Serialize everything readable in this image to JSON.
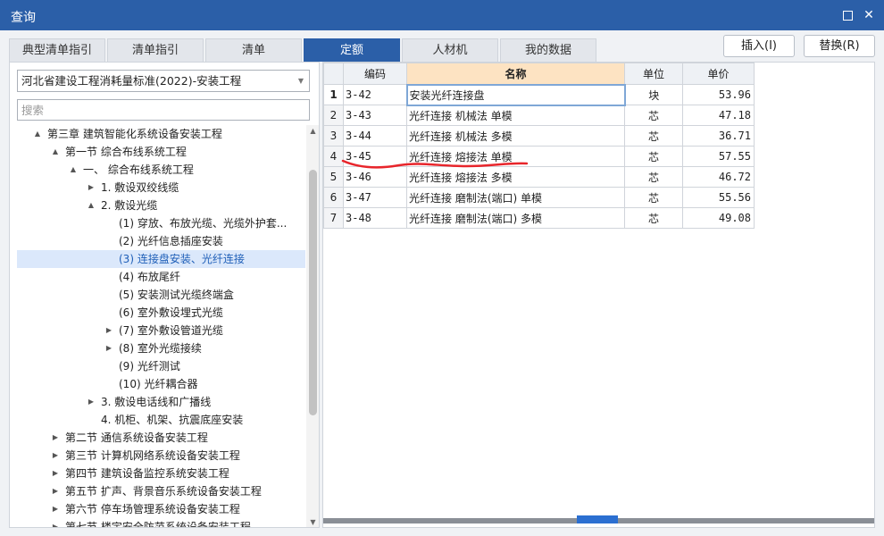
{
  "window": {
    "title": "查询",
    "max_icon": "maximize-icon",
    "close_icon": "close-icon"
  },
  "tabs": [
    {
      "label": "典型清单指引"
    },
    {
      "label": "清单指引"
    },
    {
      "label": "清单"
    },
    {
      "label": "定额",
      "active": true
    },
    {
      "label": "人材机"
    },
    {
      "label": "我的数据"
    }
  ],
  "actions": {
    "insert": "插入(I)",
    "replace": "替换(R)"
  },
  "left": {
    "standard": "河北省建设工程消耗量标准(2022)-安装工程",
    "search_placeholder": "搜索",
    "tree": [
      {
        "label": "第三章 建筑智能化系统设备安装工程",
        "toggle": "▲",
        "level": 1
      },
      {
        "label": "第一节 综合布线系统工程",
        "toggle": "▲",
        "level": 2
      },
      {
        "label": "一、 综合布线系统工程",
        "toggle": "▲",
        "level": 3
      },
      {
        "label": "1. 敷设双绞线缆",
        "toggle": "▶",
        "level": 4
      },
      {
        "label": "2. 敷设光缆",
        "toggle": "▲",
        "level": 4
      },
      {
        "label": "(1) 穿放、布放光缆、光缆外护套...",
        "toggle": "",
        "level": 5
      },
      {
        "label": "(2) 光纤信息插座安装",
        "toggle": "",
        "level": 5
      },
      {
        "label": "(3) 连接盘安装、光纤连接",
        "toggle": "",
        "level": 5,
        "selected": true
      },
      {
        "label": "(4) 布放尾纤",
        "toggle": "",
        "level": 5
      },
      {
        "label": "(5) 安装测试光缆终端盒",
        "toggle": "",
        "level": 5
      },
      {
        "label": "(6) 室外敷设埋式光缆",
        "toggle": "",
        "level": 5
      },
      {
        "label": "(7) 室外敷设管道光缆",
        "toggle": "▶",
        "level": 5
      },
      {
        "label": "(8) 室外光缆接续",
        "toggle": "▶",
        "level": 5
      },
      {
        "label": "(9) 光纤测试",
        "toggle": "",
        "level": 5
      },
      {
        "label": "(10) 光纤耦合器",
        "toggle": "",
        "level": 5
      },
      {
        "label": "3. 敷设电话线和广播线",
        "toggle": "▶",
        "level": 4
      },
      {
        "label": "4. 机柜、机架、抗震底座安装",
        "toggle": "",
        "level": 4
      },
      {
        "label": "第二节 通信系统设备安装工程",
        "toggle": "▶",
        "level": 2
      },
      {
        "label": "第三节 计算机网络系统设备安装工程",
        "toggle": "▶",
        "level": 2
      },
      {
        "label": "第四节 建筑设备监控系统安装工程",
        "toggle": "▶",
        "level": 2
      },
      {
        "label": "第五节 扩声、背景音乐系统设备安装工程",
        "toggle": "▶",
        "level": 2
      },
      {
        "label": "第六节 停车场管理系统设备安装工程",
        "toggle": "▶",
        "level": 2
      },
      {
        "label": "第七节 楼宇安全防范系统设备安装工程",
        "toggle": "▶",
        "level": 2
      }
    ]
  },
  "table": {
    "headers": [
      "",
      "编码",
      "名称",
      "单位",
      "单价"
    ],
    "rows": [
      {
        "no": "1",
        "code": "3-42",
        "name": "安装光纤连接盘",
        "unit": "块",
        "price": "53.96"
      },
      {
        "no": "2",
        "code": "3-43",
        "name": "光纤连接 机械法 单模",
        "unit": "芯",
        "price": "47.18"
      },
      {
        "no": "3",
        "code": "3-44",
        "name": "光纤连接 机械法 多模",
        "unit": "芯",
        "price": "36.71"
      },
      {
        "no": "4",
        "code": "3-45",
        "name": "光纤连接 熔接法 单模",
        "unit": "芯",
        "price": "57.55"
      },
      {
        "no": "5",
        "code": "3-46",
        "name": "光纤连接 熔接法 多模",
        "unit": "芯",
        "price": "46.72"
      },
      {
        "no": "6",
        "code": "3-47",
        "name": "光纤连接 磨制法(端口) 单模",
        "unit": "芯",
        "price": "55.56"
      },
      {
        "no": "7",
        "code": "3-48",
        "name": "光纤连接 磨制法(端口) 多模",
        "unit": "芯",
        "price": "49.08"
      }
    ],
    "scroll_marker": "1"
  },
  "colors": {
    "titlebar": "#2b5fa8",
    "active_tab": "#2b5fa8",
    "name_header": "#fde3c2",
    "selection": "#dbe8fb",
    "annotation": "#e8252b"
  }
}
